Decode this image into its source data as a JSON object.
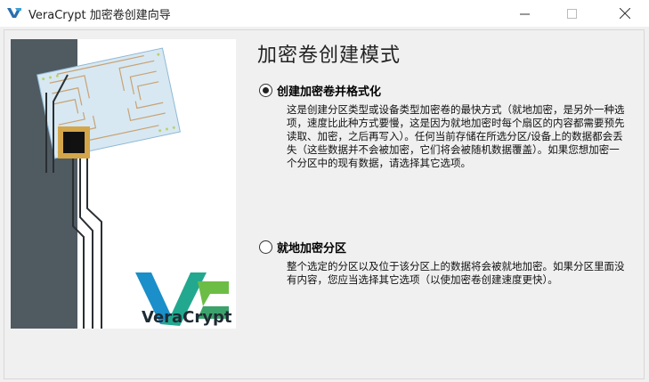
{
  "window": {
    "title": "VeraCrypt 加密卷创建向导"
  },
  "page": {
    "heading": "加密卷创建模式"
  },
  "options": [
    {
      "label": "创建加密卷并格式化",
      "selected": true,
      "description": "这是创建分区类型或设备类型加密卷的最快方式（就地加密，是另外一种选项，速度比此种方式要慢，这是因为就地加密时每个扇区的内容都需要预先读取、加密，之后再写入）。任何当前存储在所选分区/设备上的数据都会丢失（这些数据并不会被加密，它们将会被随机数据覆盖）。如果您想加密一个分区中的现有数据，请选择其它选项。"
    },
    {
      "label": "就地加密分区",
      "selected": false,
      "description": "整个选定的分区以及位于该分区上的数据将会被就地加密。如果分区里面没有内容，您应当选择其它选项（以使加密卷创建速度更快）。"
    }
  ],
  "branding": {
    "logo_text": "VeraCrypt",
    "logo_colors": [
      "#1a9fd6",
      "#22a88f",
      "#6cbd45"
    ]
  }
}
